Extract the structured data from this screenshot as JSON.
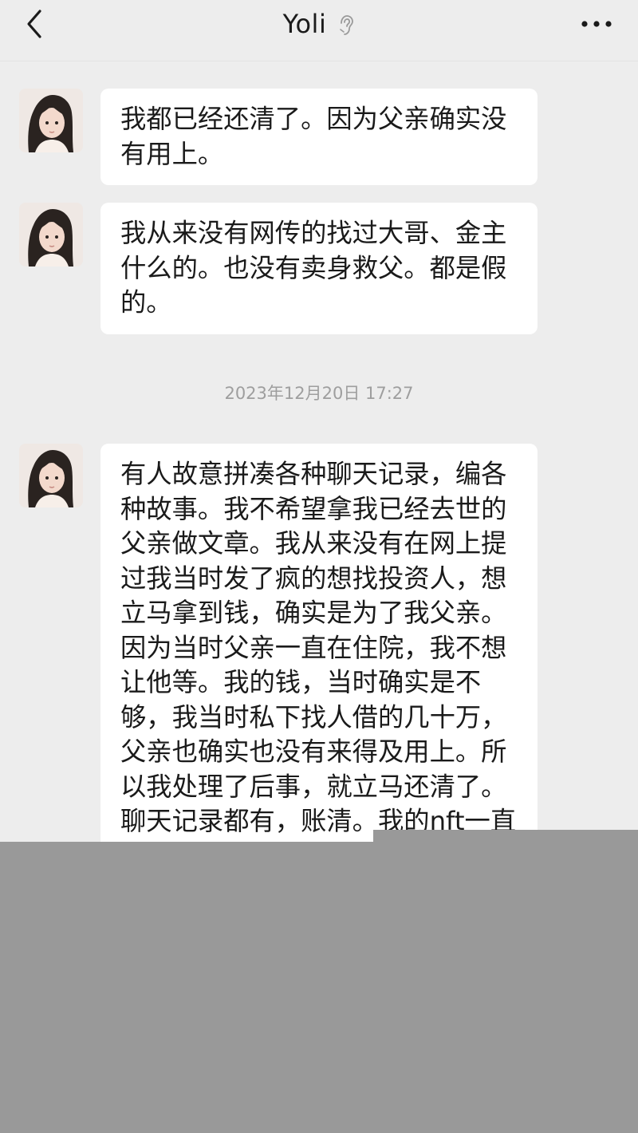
{
  "header": {
    "title": "Yoli",
    "back_icon": "chevron-left-icon",
    "mute_icon": "ear-icon",
    "more_icon": "more-dots-icon"
  },
  "messages": [
    {
      "sender": "Yoli",
      "text": "我都已经还清了。因为父亲确实没有用上。"
    },
    {
      "sender": "Yoli",
      "text": "我从来没有网传的找过大哥、金主什么的。也没有卖身救父。都是假的。"
    },
    {
      "sender": "Yoli",
      "text": "有人故意拼凑各种聊天记录，编各种故事。我不希望拿我已经去世的父亲做文章。我从来没有在网上提过我当时发了疯的想找投资人，想立马拿到钱，确实是为了我父亲。因为当时父亲一直在住院，我不想让他等。我的钱，当时确实是不够，我当时私下找人借的几十万，父亲也确实也没有来得及用上。所以我处理了后事，就立马还清了。聊天记录都有，账清。我的nft一直是"
    }
  ],
  "timestamp": "2023年12月20日 17:27",
  "colors": {
    "background": "#ededed",
    "bubble": "#ffffff",
    "text": "#1a1a1a",
    "timestamp": "#9e9e9e",
    "overlay": "#999999"
  }
}
